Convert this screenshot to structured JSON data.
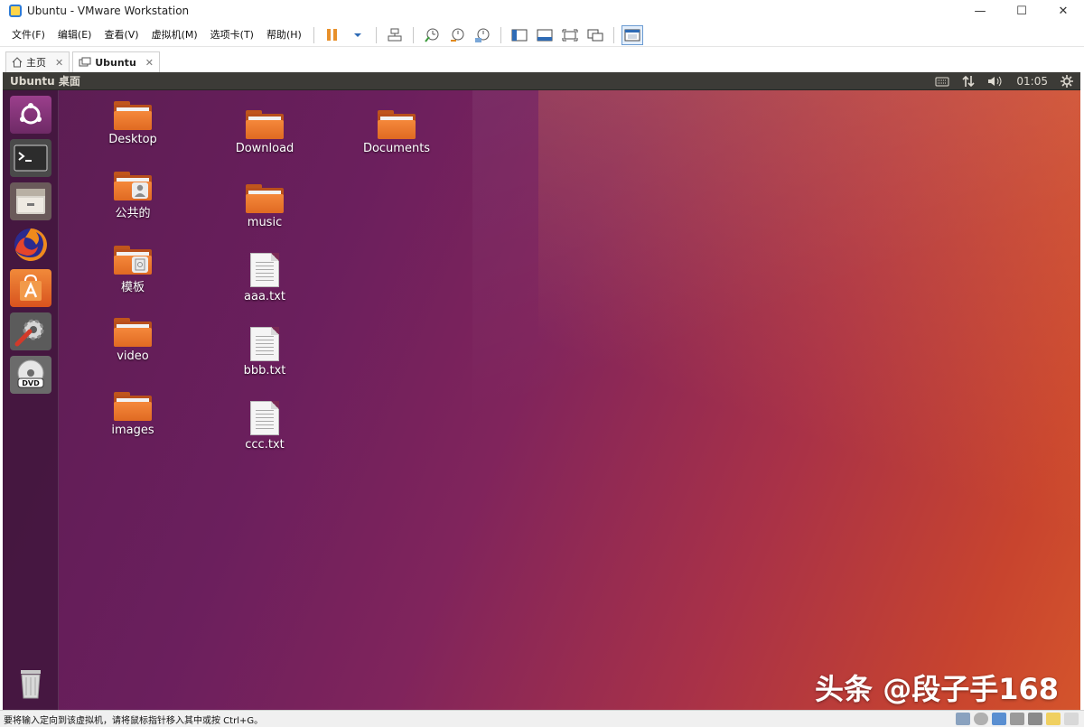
{
  "window": {
    "title": "Ubuntu - VMware Workstation"
  },
  "menu": [
    "文件(F)",
    "编辑(E)",
    "查看(V)",
    "虚拟机(M)",
    "选项卡(T)",
    "帮助(H)"
  ],
  "tabs": [
    {
      "label": "主页"
    },
    {
      "label": "Ubuntu"
    }
  ],
  "vm": {
    "topbar_title": "Ubuntu 桌面",
    "clock": "01:05"
  },
  "desktop_items": [
    {
      "label": "Desktop",
      "kind": "folder"
    },
    {
      "label": "Download",
      "kind": "folder"
    },
    {
      "label": "Documents",
      "kind": "folder"
    },
    {
      "label": "公共的",
      "kind": "folder-shared"
    },
    {
      "label": "music",
      "kind": "folder"
    },
    {
      "label": "模板",
      "kind": "folder-templates"
    },
    {
      "label": "aaa.txt",
      "kind": "text-file"
    },
    {
      "label": "video",
      "kind": "folder"
    },
    {
      "label": "bbb.txt",
      "kind": "text-file"
    },
    {
      "label": "images",
      "kind": "folder"
    },
    {
      "label": "ccc.txt",
      "kind": "text-file"
    }
  ],
  "launcher": [
    "ubuntu-dash-icon",
    "terminal-icon",
    "file-manager-icon",
    "firefox-icon",
    "software-center-icon",
    "system-settings-icon",
    "dvd-icon",
    "trash-icon"
  ],
  "watermark": "头条 @段子手168",
  "statusbar": {
    "text": "要将输入定向到该虚拟机，请将鼠标指针移入其中或按 Ctrl+G。"
  },
  "colors": {
    "ubuntu_topbar": "#3c3b37",
    "folder_orange": "#f07a2e",
    "desktop_purple": "#6b1f5d",
    "desktop_orange": "#d4542c"
  }
}
